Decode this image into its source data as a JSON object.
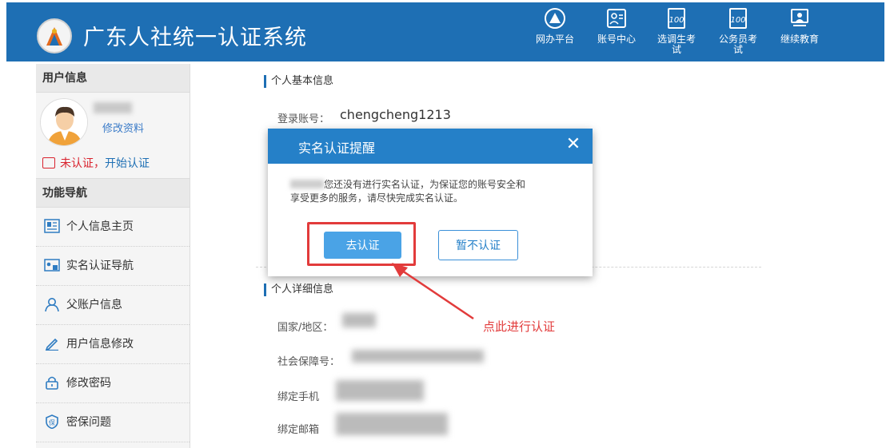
{
  "header": {
    "site_title": "广东人社统一认证系统",
    "bg_color": "#1e6fb4",
    "nav": [
      {
        "label": "网办平台",
        "icon": "portal-icon"
      },
      {
        "label": "账号中心",
        "icon": "account-icon"
      },
      {
        "label": "选调生考试",
        "icon": "exam-icon"
      },
      {
        "label": "公务员考试",
        "icon": "exam-icon"
      },
      {
        "label": "继续教育",
        "icon": "education-icon"
      }
    ]
  },
  "sidebar": {
    "user_info_heading": "用户信息",
    "edit_profile": "修改资料",
    "auth_status": "未认证，",
    "start_auth": "开始认证",
    "nav_heading": "功能导航",
    "items": [
      {
        "label": "个人信息主页",
        "icon": "id-card-icon"
      },
      {
        "label": "实名认证导航",
        "icon": "verify-card-icon"
      },
      {
        "label": "父账户信息",
        "icon": "user-icon"
      },
      {
        "label": "用户信息修改",
        "icon": "pencil-icon"
      },
      {
        "label": "修改密码",
        "icon": "lock-icon"
      },
      {
        "label": "密保问题",
        "icon": "shield-icon"
      }
    ]
  },
  "main": {
    "basic_section": "个人基本信息",
    "login_label": "登录账号：",
    "login_value": "chengcheng1213",
    "detail_section": "个人详细信息",
    "country_label": "国家/地区：",
    "ssn_label": "社会保障号：",
    "phone_label": "绑定手机",
    "email_label": "绑定邮箱"
  },
  "modal": {
    "title": "实名认证提醒",
    "close": "✕",
    "message_line1": "您还没有进行实名认证，为保证您的账号安全和",
    "message_line2": "享受更多的服务，请尽快完成实名认证。",
    "confirm_button": "去认证",
    "cancel_button": "暂不认证"
  },
  "annotation": {
    "text": "点此进行认证",
    "color": "#e23b3b"
  }
}
